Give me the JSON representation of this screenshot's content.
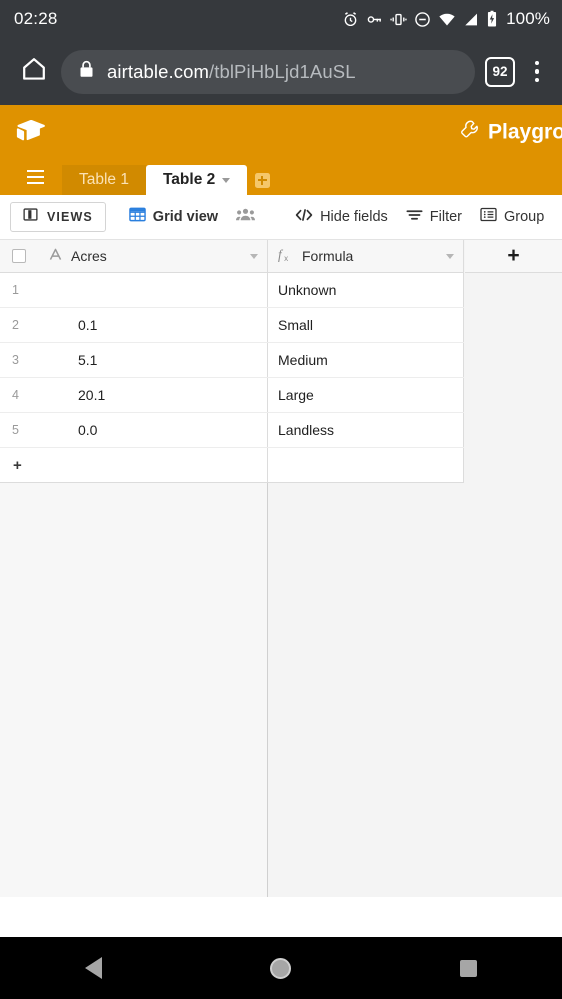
{
  "status_bar": {
    "clock": "02:28",
    "battery_percent": "100%",
    "icons": [
      "alarm-icon",
      "vpn-key-icon",
      "vibrate-icon",
      "do-not-disturb-icon",
      "wifi-icon",
      "cell-signal-icon",
      "battery-charging-icon"
    ]
  },
  "browser": {
    "home_icon": "home-icon",
    "lock_icon": "lock-icon",
    "url_domain": "airtable.com",
    "url_path": "/tblPiHbLjd1AuSL",
    "tab_count": "92",
    "menu_icon": "overflow-menu-icon"
  },
  "app_header": {
    "logo_icon": "airtable-logo-icon",
    "workspace_icon": "wrench-icon",
    "workspace_title": "Playgrou",
    "brand_color": "#df9200"
  },
  "tabs": {
    "menu_icon": "hamburger-icon",
    "items": [
      {
        "label": "Table 1",
        "active": false
      },
      {
        "label": "Table 2",
        "active": true
      }
    ],
    "add_tab_label": "+"
  },
  "toolbar": {
    "views_label": "VIEWS",
    "views_icon": "panel-icon",
    "grid_view_label": "Grid view",
    "grid_view_icon": "grid-icon",
    "collaborators_icon": "people-icon",
    "hide_fields_label": "Hide fields",
    "hide_fields_icon": "code-brackets-icon",
    "filter_label": "Filter",
    "filter_icon": "funnel-icon",
    "group_label": "Group",
    "group_icon": "list-icon"
  },
  "grid": {
    "select_all_icon": "checkbox-icon",
    "add_field_label": "+",
    "add_row_label": "+",
    "columns": [
      {
        "name": "Acres",
        "type_icon": "text-field-icon"
      },
      {
        "name": "Formula",
        "type_icon": "formula-icon"
      }
    ],
    "rows": [
      {
        "num": "1",
        "acres": "",
        "formula": "Unknown"
      },
      {
        "num": "2",
        "acres": "0.1",
        "formula": "Small"
      },
      {
        "num": "3",
        "acres": "5.1",
        "formula": "Medium"
      },
      {
        "num": "4",
        "acres": "20.1",
        "formula": "Large"
      },
      {
        "num": "5",
        "acres": "0.0",
        "formula": "Landless"
      }
    ]
  },
  "nav_bar": {
    "back_icon": "back-triangle-icon",
    "home_icon": "home-circle-icon",
    "recents_icon": "recents-square-icon"
  }
}
